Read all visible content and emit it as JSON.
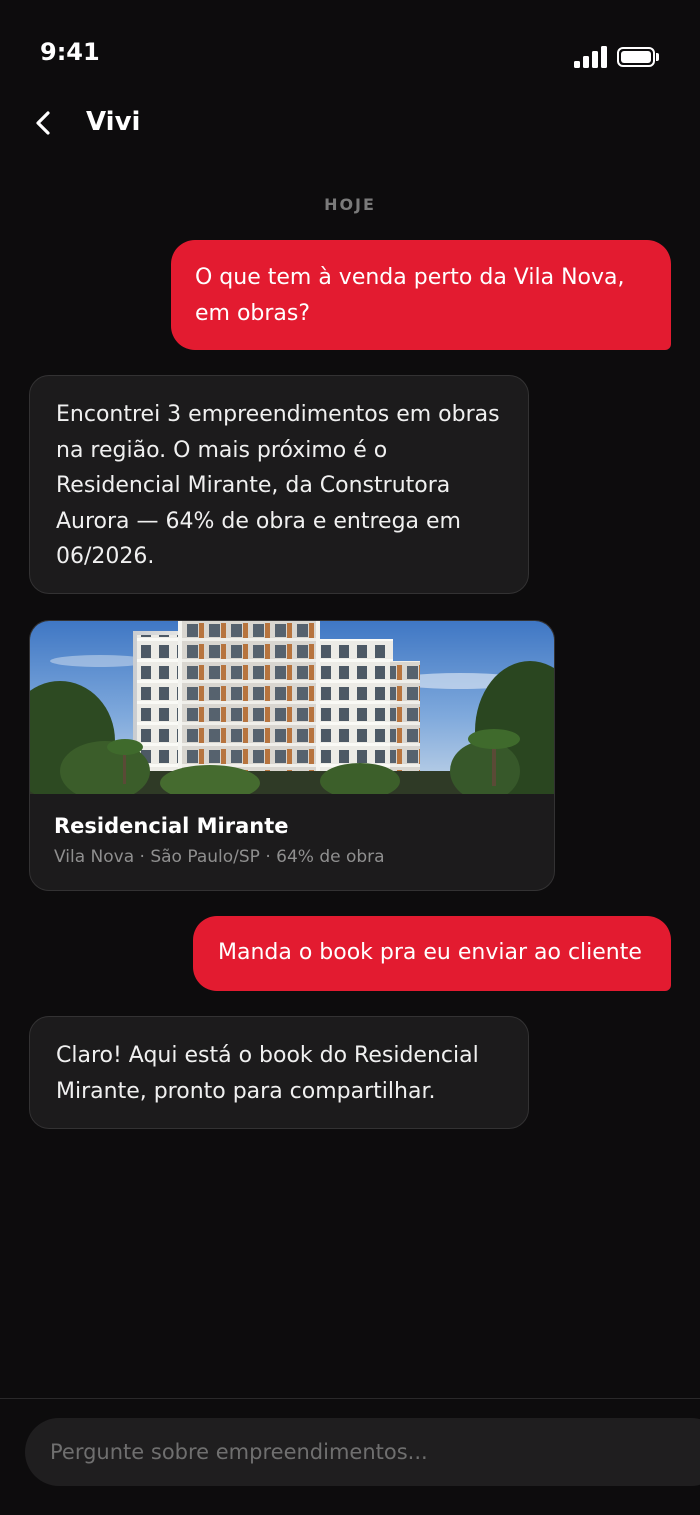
{
  "status_bar": {
    "time": "9:41",
    "signal_icon": "cellular-signal-icon",
    "battery_icon": "battery-icon"
  },
  "header": {
    "back_icon": "chevron-left-icon",
    "title": "Vivi"
  },
  "chat": {
    "day_label": "HOJE",
    "messages": [
      {
        "from": "user",
        "text": "O que tem à venda perto da Vila Nova,\nem obras?"
      },
      {
        "from": "assistant",
        "text": "Encontrei 3 empreendimentos em obras\nna região. O mais próximo é o\nResidencial Mirante, da Construtora\nAurora — 64% de obra e entrega em\n06/2026."
      },
      {
        "from": "assistant",
        "type": "property-card",
        "title": "Residencial Mirante",
        "subtitle": "Vila Nova · São Paulo/SP · 64% de obra"
      },
      {
        "from": "user",
        "text": "Manda o book pra eu enviar ao cliente"
      },
      {
        "from": "assistant",
        "text": "Claro! Aqui está o book do Residencial\nMirante, pronto para compartilhar."
      }
    ]
  },
  "composer": {
    "value": "",
    "placeholder": "Pergunte sobre empreendimentos..."
  },
  "colors": {
    "background": "#0d0c0d",
    "accent": "#e31b30",
    "bot_bubble": "#1c1b1c",
    "muted_text": "#8f8f8f"
  }
}
